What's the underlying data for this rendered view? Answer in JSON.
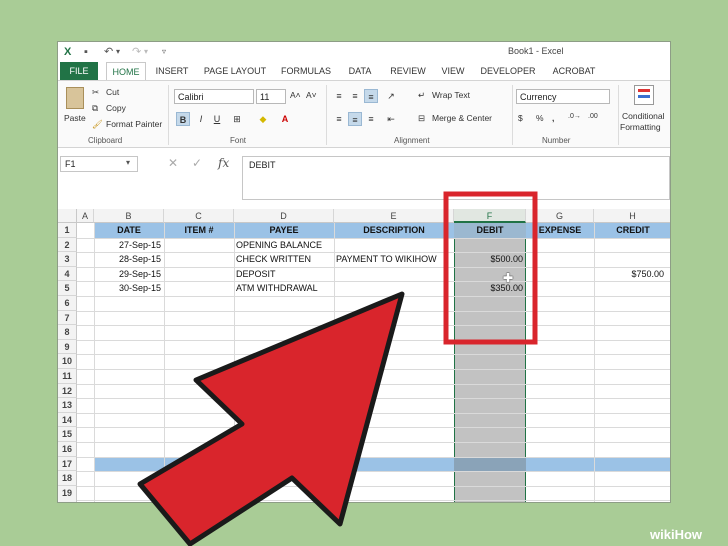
{
  "window": {
    "title": "Book1 - Excel"
  },
  "tabs": [
    "FILE",
    "HOME",
    "INSERT",
    "PAGE LAYOUT",
    "FORMULAS",
    "DATA",
    "REVIEW",
    "VIEW",
    "DEVELOPER",
    "ACROBAT"
  ],
  "ribbon": {
    "clipboard": {
      "paste": "Paste",
      "cut": "Cut",
      "copy": "Copy",
      "format_painter": "Format Painter",
      "group": "Clipboard"
    },
    "font": {
      "name": "Calibri",
      "size": "11",
      "group": "Font"
    },
    "alignment": {
      "wrap": "Wrap Text",
      "merge": "Merge & Center",
      "group": "Alignment"
    },
    "number": {
      "format": "Currency",
      "group": "Number",
      "dollar": "$",
      "percent": "%",
      "comma": ","
    },
    "styles": {
      "conditional_1": "Conditional",
      "conditional_2": "Formatting"
    }
  },
  "formula_bar": {
    "name_box": "F1",
    "fx": "fx",
    "content": "DEBIT"
  },
  "sheet": {
    "columns": [
      "A",
      "B",
      "C",
      "D",
      "E",
      "F",
      "G",
      "H"
    ],
    "selected_column": "F",
    "rows": [
      "1",
      "2",
      "3",
      "4",
      "5",
      "6",
      "7",
      "8",
      "9",
      "10",
      "11",
      "12",
      "13",
      "14",
      "15",
      "16",
      "17",
      "18",
      "19"
    ],
    "header_row": [
      "",
      "DATE",
      "ITEM #",
      "PAYEE",
      "DESCRIPTION",
      "DEBIT",
      "EXPENSE",
      "CREDIT"
    ],
    "data": [
      {
        "date": "27-Sep-15",
        "payee": "OPENING BALANCE",
        "description": "",
        "debit": "",
        "credit": ""
      },
      {
        "date": "28-Sep-15",
        "payee": "CHECK WRITTEN",
        "description": "PAYMENT TO WIKIHOW",
        "debit": "$500.00",
        "credit": ""
      },
      {
        "date": "29-Sep-15",
        "payee": "DEPOSIT",
        "description": "",
        "debit": "",
        "credit": "$750.00"
      },
      {
        "date": "30-Sep-15",
        "payee": "ATM WITHDRAWAL",
        "description": "",
        "debit": "$350.00",
        "credit": ""
      }
    ]
  },
  "colors": {
    "header_band": "#9bc2e6",
    "row17_band": "#9bc2e6",
    "selected_col": "#c2c2c2",
    "excel_green": "#217346",
    "arrow": "#d9252c",
    "box": "#d9252c"
  },
  "watermark": {
    "wiki": "wiki",
    "how": "How"
  }
}
